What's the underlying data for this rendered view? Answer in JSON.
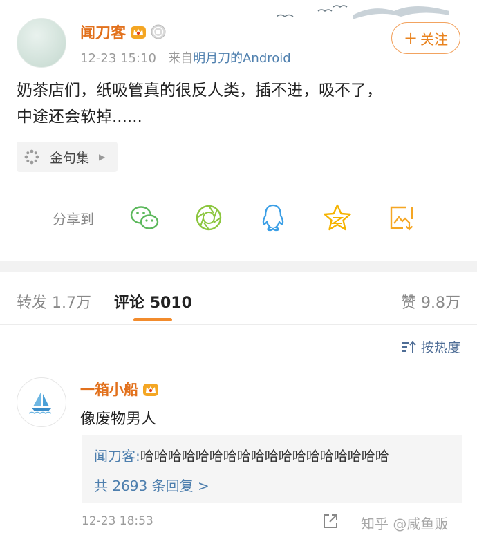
{
  "post": {
    "author": "闻刀客",
    "time": "12-23 15:10",
    "source_prefix": "来自",
    "source_name": "明月刀的Android",
    "follow_label": "关注",
    "content_line1": "奶茶店们，纸吸管真的很反人类，插不进，吸不了，",
    "content_line2": "中途还会软掉......",
    "topic": "金句集",
    "share_label": "分享到",
    "share_icons": [
      "wechat-icon",
      "moments-icon",
      "qq-icon",
      "qzone-icon",
      "save-image-icon"
    ]
  },
  "tabs": {
    "repost": "转发 1.7万",
    "comment_label": "评论",
    "comment_count": "5010",
    "like": "赞 9.8万"
  },
  "sort_label": "按热度",
  "comment": {
    "author": "一箱小船",
    "text": "像废物男人",
    "reply_user": "闻刀客:",
    "reply_text": "哈哈哈哈哈哈哈哈哈哈哈哈哈哈哈哈哈哈",
    "more_replies": "共 2693 条回复 >",
    "time": "12-23 18:53"
  },
  "watermark": "知乎 @咸鱼贩",
  "colors": {
    "accent": "#e2711d",
    "link": "#4e7fae",
    "tab_underline": "#f28b2c"
  }
}
